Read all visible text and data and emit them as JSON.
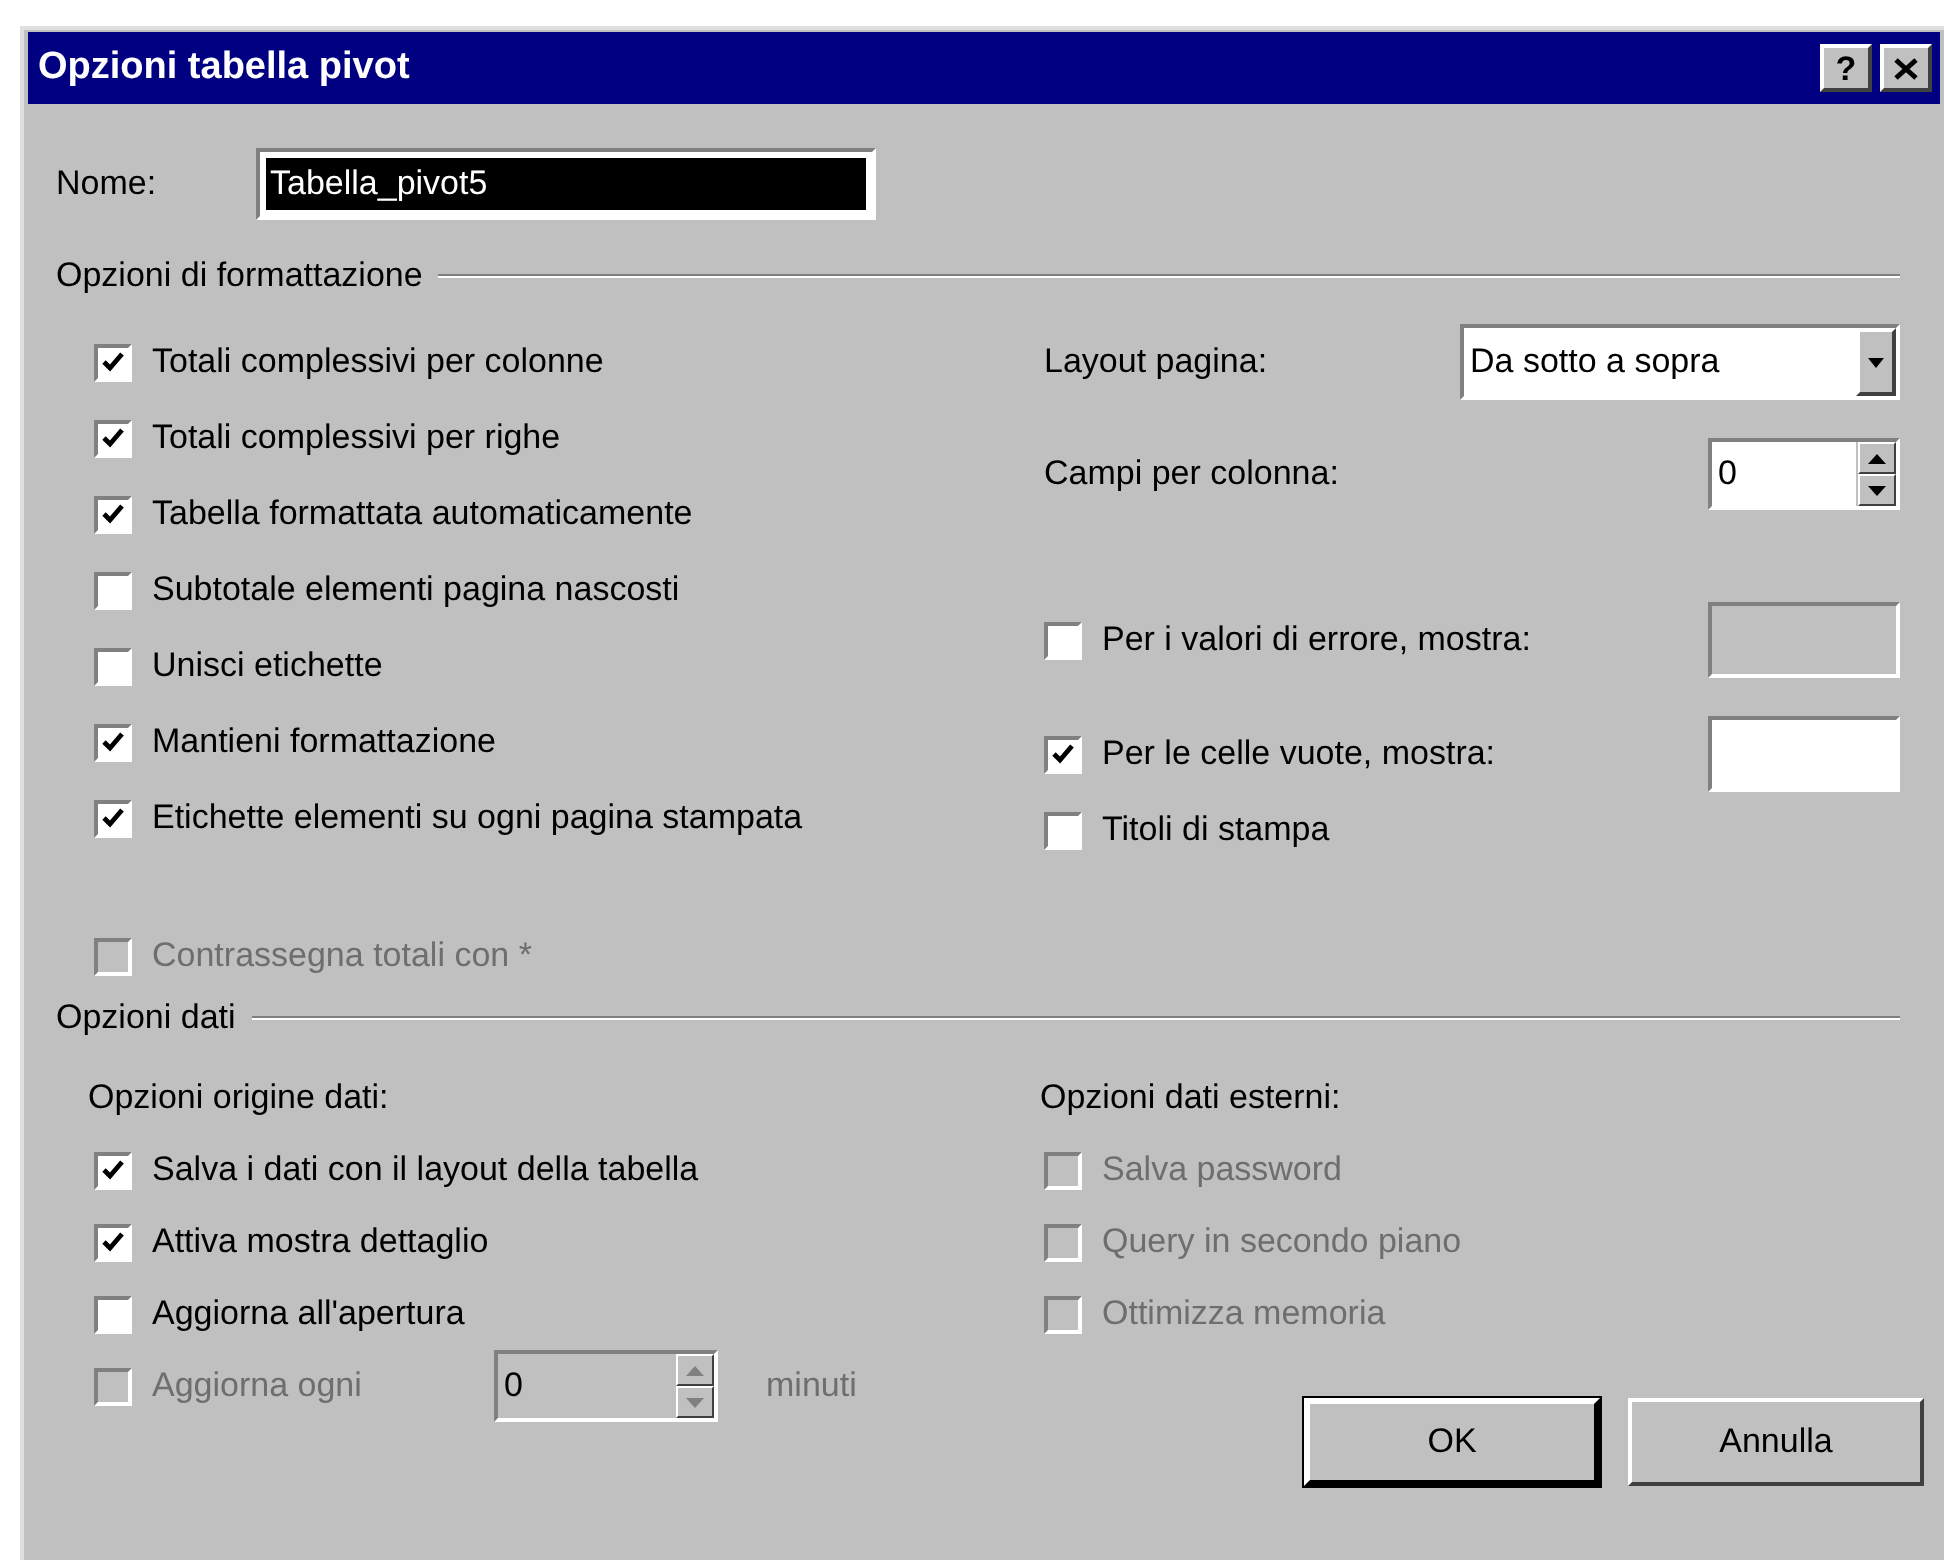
{
  "window": {
    "title": "Opzioni tabella pivot",
    "help": "?"
  },
  "name": {
    "label": "Nome:",
    "value": "Tabella_pivot5",
    "selected": true
  },
  "formatting": {
    "title": "Opzioni di formattazione",
    "options": [
      {
        "label": "Totali complessivi per colonne",
        "checked": true,
        "disabled": false
      },
      {
        "label": "Totali complessivi per righe",
        "checked": true,
        "disabled": false
      },
      {
        "label": "Tabella formattata automaticamente",
        "checked": true,
        "disabled": false
      },
      {
        "label": "Subtotale elementi pagina nascosti",
        "checked": false,
        "disabled": false
      },
      {
        "label": "Unisci etichette",
        "checked": false,
        "disabled": false
      },
      {
        "label": "Mantieni formattazione",
        "checked": true,
        "disabled": false
      },
      {
        "label": "Etichette elementi su ogni pagina stampata",
        "checked": true,
        "disabled": false
      }
    ],
    "mark_totals": {
      "label": "Contrassegna totali con *",
      "checked": false,
      "disabled": true
    },
    "page_layout": {
      "label": "Layout pagina:",
      "value": "Da sotto a sopra"
    },
    "fields_per_column": {
      "label": "Campi per colonna:",
      "value": "0"
    },
    "right_options": [
      {
        "label": "Per i valori di errore, mostra:",
        "checked": false,
        "disabled": false,
        "field_disabled": true
      },
      {
        "label": "Per le celle vuote, mostra:",
        "checked": true,
        "disabled": false,
        "field_disabled": false
      }
    ],
    "print_titles": {
      "label": "Titoli di stampa",
      "checked": false,
      "disabled": false
    }
  },
  "data": {
    "title": "Opzioni dati",
    "source": {
      "title": "Opzioni origine dati:",
      "options": [
        {
          "label": "Salva i dati con il layout della tabella",
          "checked": true,
          "disabled": false
        },
        {
          "label": "Attiva mostra dettaglio",
          "checked": true,
          "disabled": false
        },
        {
          "label": "Aggiorna all'apertura",
          "checked": false,
          "disabled": false
        }
      ],
      "refresh_every": {
        "label": "Aggiorna ogni",
        "value": "0",
        "unit": "minuti",
        "checked": false,
        "disabled": true
      }
    },
    "external": {
      "title": "Opzioni dati esterni:",
      "options": [
        {
          "label": "Salva password",
          "checked": false,
          "disabled": true
        },
        {
          "label": "Query in secondo piano",
          "checked": false,
          "disabled": true
        },
        {
          "label": "Ottimizza memoria",
          "checked": false,
          "disabled": true
        }
      ]
    }
  },
  "buttons": [
    {
      "label": "OK",
      "default": true
    },
    {
      "label": "Annulla",
      "default": false
    }
  ]
}
